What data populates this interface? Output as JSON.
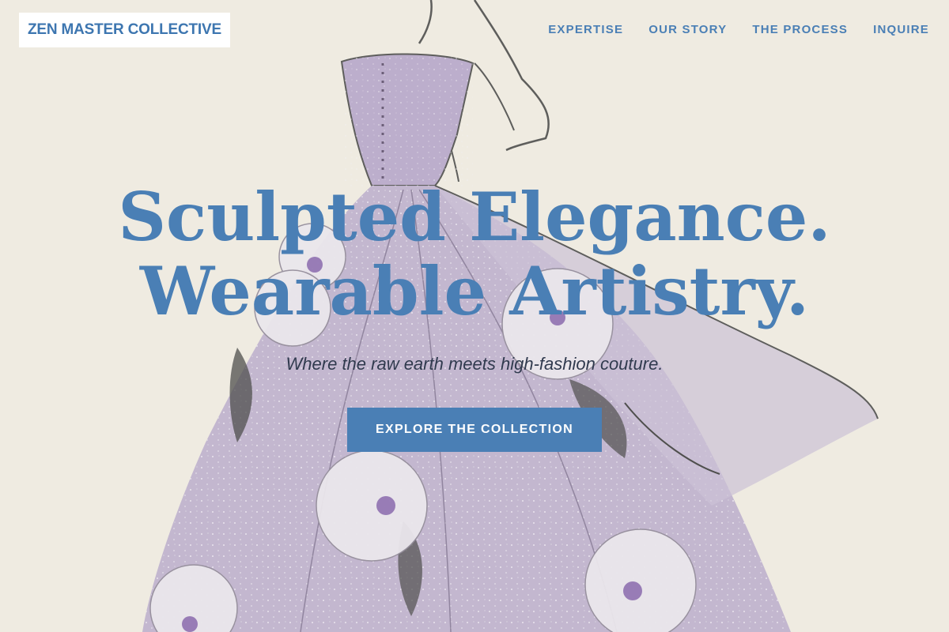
{
  "brand": {
    "name": "ZEN MASTER COLLECTIVE"
  },
  "nav": {
    "items": [
      {
        "label": "EXPERTISE"
      },
      {
        "label": "OUR STORY"
      },
      {
        "label": "THE PROCESS"
      },
      {
        "label": "INQUIRE"
      }
    ]
  },
  "hero": {
    "headline_line1": "Sculpted Elegance.",
    "headline_line2": "Wearable Artistry.",
    "tagline": "Where the raw earth meets high-fashion couture.",
    "cta_label": "EXPLORE THE COLLECTION",
    "illustration": "watercolor-couture-gown-sketch"
  },
  "colors": {
    "accent": "#4a7fb5",
    "page_background": "#efebe2",
    "gown": "#b4a5c8",
    "tagline": "#303a4e"
  }
}
